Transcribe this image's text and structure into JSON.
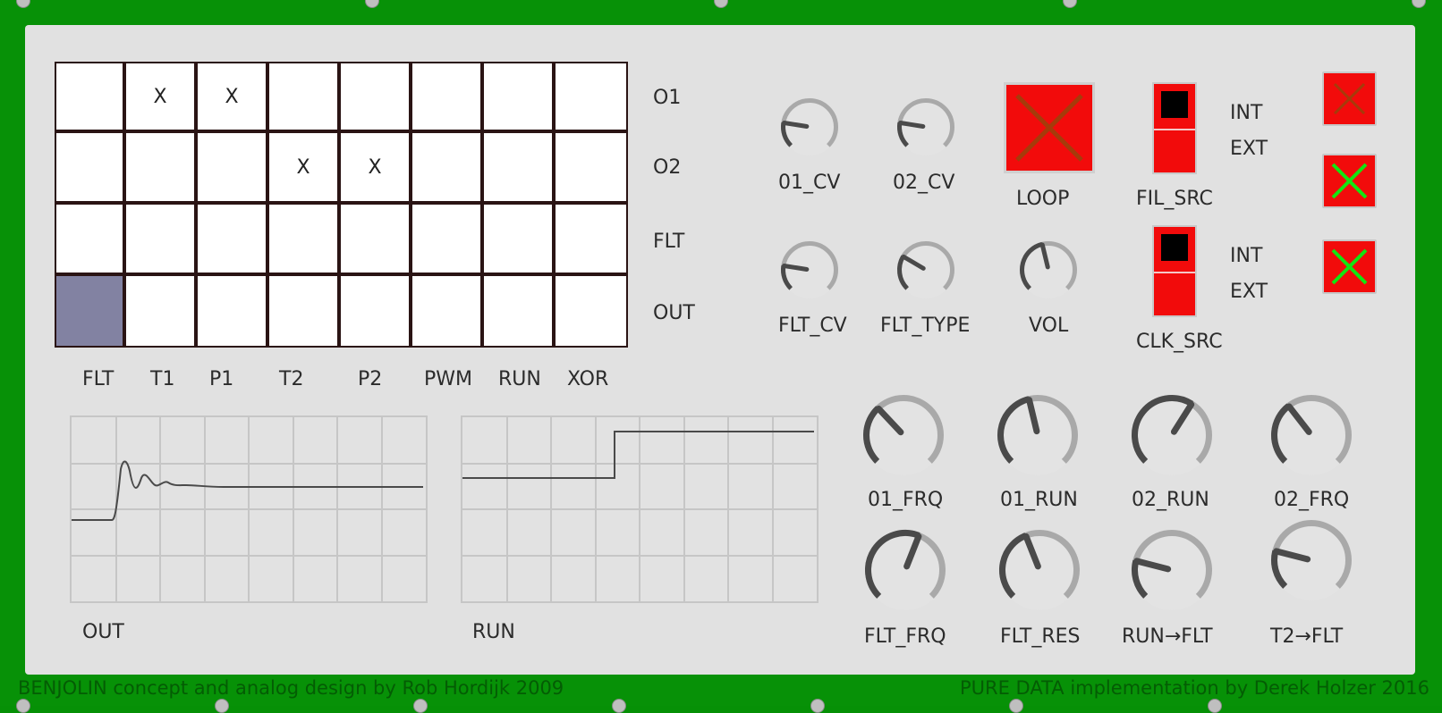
{
  "app": {
    "title": "BENJOLIN",
    "colors": {
      "frame": "#079107",
      "panel": "#e1e1e1",
      "toggle_on": "#f20b0b",
      "check_green": "#12e512",
      "check_dim": "#a63b0a",
      "selected_cell": "#8282a2"
    }
  },
  "matrix": {
    "rows": [
      "O1",
      "O2",
      "FLT",
      "OUT"
    ],
    "cols": [
      "FLT",
      "T1",
      "P1",
      "T2",
      "P2",
      "PWM",
      "RUN",
      "XOR"
    ],
    "cells": [
      [
        "",
        "X",
        "X",
        "",
        "",
        "",
        "",
        ""
      ],
      [
        "",
        "",
        "",
        "X",
        "X",
        "",
        "",
        ""
      ],
      [
        "",
        "",
        "",
        "",
        "",
        "",
        "",
        ""
      ],
      [
        "",
        "",
        "",
        "",
        "",
        "",
        "",
        ""
      ]
    ],
    "selected": {
      "row": 3,
      "col": 0
    }
  },
  "scopes": [
    {
      "label": "OUT"
    },
    {
      "label": "RUN"
    }
  ],
  "small_knobs": [
    {
      "label": "01_CV",
      "value": 0.2
    },
    {
      "label": "02_CV",
      "value": 0.2
    },
    {
      "label": "FLT_CV",
      "value": 0.2
    },
    {
      "label": "FLT_TYPE",
      "value": 0.28
    },
    {
      "label": "VOL",
      "value": 0.45
    }
  ],
  "big_knobs": [
    {
      "label": "01_FRQ",
      "value": 0.34
    },
    {
      "label": "01_RUN",
      "value": 0.45
    },
    {
      "label": "02_RUN",
      "value": 0.62
    },
    {
      "label": "02_FRQ",
      "value": 0.36
    },
    {
      "label": "FLT_FRQ",
      "value": 0.58
    },
    {
      "label": "FLT_RES",
      "value": 0.42
    },
    {
      "label": "RUN→FLT",
      "value": 0.22
    },
    {
      "label": "T2→FLT",
      "value": 0.22
    }
  ],
  "loop": {
    "label": "LOOP",
    "on": true
  },
  "fil_src": {
    "label": "FIL_SRC",
    "int": "INT",
    "ext": "EXT",
    "selected": "INT"
  },
  "clk_src": {
    "label": "CLK_SRC",
    "int": "INT",
    "ext": "EXT",
    "selected": "INT"
  },
  "side_toggles": [
    {
      "state": "dim",
      "on": false
    },
    {
      "state": "checked",
      "on": true
    },
    {
      "state": "checked",
      "on": true
    }
  ],
  "credits": {
    "left": "BENJOLIN concept and analog design by Rob Hordijk 2009",
    "right": "PURE DATA implementation by Derek Holzer 2016"
  }
}
